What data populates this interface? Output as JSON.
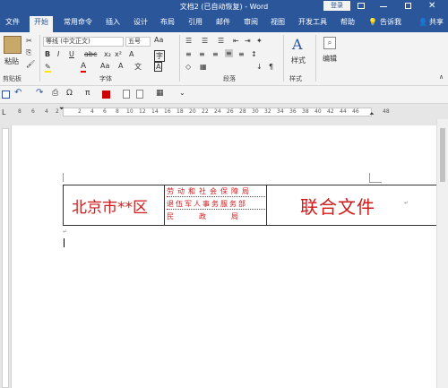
{
  "titlebar": {
    "title": "文档2 (已自动恢复) - Word",
    "login": "登录"
  },
  "tabs": [
    "文件",
    "开始",
    "常用命令",
    "插入",
    "设计",
    "布局",
    "引用",
    "邮件",
    "审阅",
    "视图",
    "开发工具",
    "帮助",
    "告诉我",
    "共享"
  ],
  "ribbon": {
    "clipboard": {
      "paste": "粘贴",
      "label": "剪贴板"
    },
    "font": {
      "font_name": "等线 (中文正文)",
      "font_size": "五号",
      "label": "字体"
    },
    "paragraph": {
      "label": "段落"
    },
    "styles": {
      "button": "样式",
      "label": "样式"
    },
    "editing": {
      "button": "编辑"
    }
  },
  "ruler": {
    "numbers": [
      "8",
      "6",
      "4",
      "2",
      "2",
      "4",
      "6",
      "8",
      "10",
      "12",
      "14",
      "16",
      "18",
      "20",
      "22",
      "24",
      "26",
      "28",
      "30",
      "32",
      "34",
      "36",
      "38",
      "40",
      "42",
      "44",
      "46",
      "48"
    ]
  },
  "document": {
    "district": "北京市**区",
    "orgs": [
      "劳动和社会保障局",
      "退伍军人事务服务部",
      "民政局"
    ],
    "joint_title": "联合文件",
    "para_mark": "↵"
  },
  "colors": {
    "accent": "#2b579a",
    "doc_red": "#d01a1a"
  }
}
